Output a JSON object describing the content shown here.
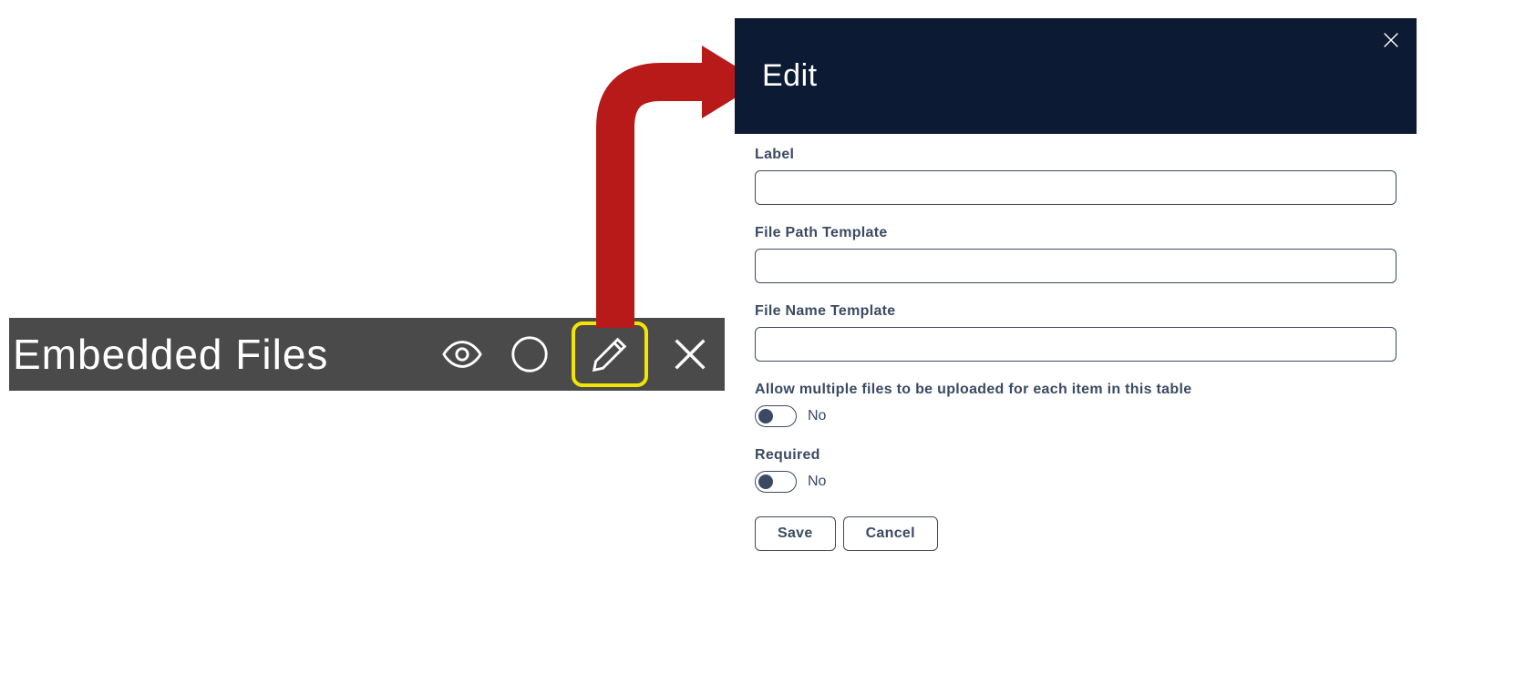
{
  "toolbar": {
    "title": "Embedded Files"
  },
  "panel": {
    "title": "Edit",
    "fields": {
      "label": {
        "label": "Label",
        "value": ""
      },
      "file_path_template": {
        "label": "File Path Template",
        "value": ""
      },
      "file_name_template": {
        "label": "File Name Template",
        "value": ""
      },
      "allow_multiple": {
        "label": "Allow multiple files to be uploaded for each item in this table",
        "value_text": "No"
      },
      "required": {
        "label": "Required",
        "value_text": "No"
      }
    },
    "buttons": {
      "save": "Save",
      "cancel": "Cancel"
    }
  }
}
